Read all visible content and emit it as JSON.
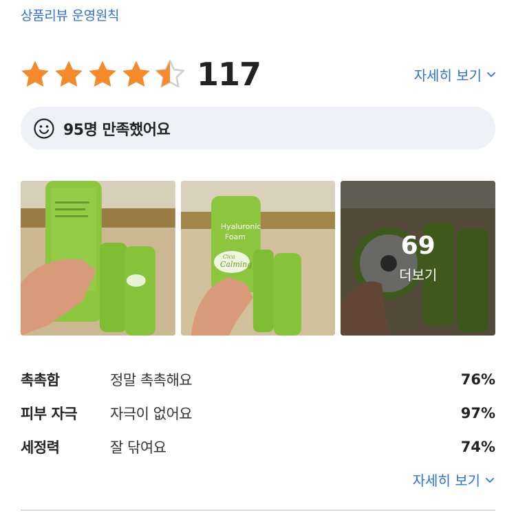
{
  "policy_link": "상품리뷰 운영원칙",
  "rating": {
    "score": 4.5,
    "max": 5,
    "count": "117",
    "star_color": "#f58a2b",
    "empty_star_color": "#d0d0d0"
  },
  "detail_link": {
    "label": "자세히 보기",
    "icon": "chevron-down-icon"
  },
  "satisfaction": {
    "icon": "smile-icon",
    "text": "95명 만족했어요"
  },
  "photos": {
    "more": {
      "count": "69",
      "label": "더보기"
    },
    "brand_texts": {
      "hyaluronic": "Hyaluronic",
      "foam": "Foam",
      "cica": "Cica",
      "calming": "Calming"
    }
  },
  "attributes": [
    {
      "name": "촉촉함",
      "value": "정말 촉촉해요",
      "percent": "76%"
    },
    {
      "name": "피부 자극",
      "value": "자극이 없어요",
      "percent": "97%"
    },
    {
      "name": "세정력",
      "value": "잘 닦여요",
      "percent": "74%"
    }
  ],
  "detail_link_bottom": {
    "label": "자세히 보기",
    "icon": "chevron-down-icon"
  },
  "colors": {
    "link": "#2f6fd6",
    "pill_bg": "#eef1f6",
    "tube_green": "#8cc63f"
  }
}
